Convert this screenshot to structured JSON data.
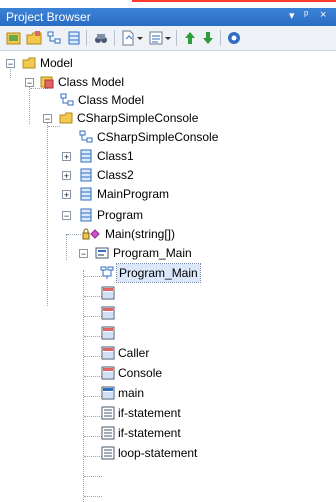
{
  "window": {
    "title": "Project Browser",
    "controls": [
      "▾",
      "ᵖ",
      "×"
    ]
  },
  "toolbar": {
    "icons": [
      "new-model-icon",
      "new-package-icon",
      "new-diagram-icon",
      "new-element-icon",
      "find-icon",
      "document-icon",
      "dropdown-icon",
      "properties-icon",
      "dropdown-icon",
      "move-up-icon",
      "move-down-icon",
      "help-icon"
    ]
  },
  "tree": {
    "items": [
      {
        "label": "Model",
        "level": 0
      },
      {
        "label": "Class Model",
        "level": 1
      },
      {
        "label": "Class Model",
        "level": 2
      },
      {
        "label": "CSharpSimpleConsole",
        "level": 2
      },
      {
        "label": "CSharpSimpleConsole",
        "level": 3
      },
      {
        "label": "Class1",
        "level": 3
      },
      {
        "label": "Class2",
        "level": 3
      },
      {
        "label": "MainProgram",
        "level": 3
      },
      {
        "label": "Program",
        "level": 3
      },
      {
        "label": "Main(string[])",
        "level": 4
      },
      {
        "label": "Program_Main",
        "level": 4
      },
      {
        "label": "Program_Main",
        "level": 5,
        "selected": true
      },
      {
        "label": "",
        "level": 5
      },
      {
        "label": "",
        "level": 5
      },
      {
        "label": "",
        "level": 5
      },
      {
        "label": "Caller",
        "level": 5
      },
      {
        "label": "Console",
        "level": 5
      },
      {
        "label": "main",
        "level": 5
      },
      {
        "label": "if-statement",
        "level": 5
      },
      {
        "label": "if-statement",
        "level": 5
      },
      {
        "label": "loop-statement",
        "level": 5
      }
    ]
  },
  "colors": {
    "titlebar": "#2a6cc4",
    "selection": "#dbe7fb",
    "folder": "#f2c94c",
    "class": "#2f6fc1"
  }
}
